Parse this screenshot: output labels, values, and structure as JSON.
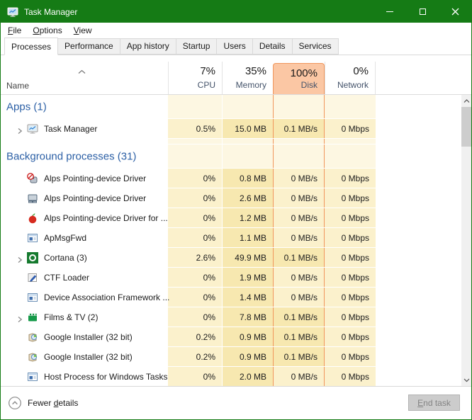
{
  "title_bar": {
    "title": "Task Manager"
  },
  "menu_bar": {
    "items": [
      {
        "key": "F",
        "rest": "ile"
      },
      {
        "key": "O",
        "rest": "ptions"
      },
      {
        "key": "V",
        "rest": "iew"
      }
    ]
  },
  "tabs": [
    {
      "label": "Processes",
      "active": true
    },
    {
      "label": "Performance",
      "active": false
    },
    {
      "label": "App history",
      "active": false
    },
    {
      "label": "Startup",
      "active": false
    },
    {
      "label": "Users",
      "active": false
    },
    {
      "label": "Details",
      "active": false
    },
    {
      "label": "Services",
      "active": false
    }
  ],
  "columns": {
    "name_label": "Name",
    "sort_direction": "ascending",
    "value_cols": [
      {
        "pct": "7%",
        "label": "CPU",
        "highlight": false
      },
      {
        "pct": "35%",
        "label": "Memory",
        "highlight": false
      },
      {
        "pct": "100%",
        "label": "Disk",
        "highlight": true
      },
      {
        "pct": "0%",
        "label": "Network",
        "highlight": false
      }
    ]
  },
  "rows": [
    {
      "type": "group",
      "label": "Apps (1)"
    },
    {
      "type": "proc",
      "label": "Task Manager",
      "icon": "task-manager",
      "expandable": true,
      "cells": [
        "0.5%",
        "15.0 MB",
        "0.1 MB/s",
        "0 Mbps"
      ],
      "heat": [
        "v0",
        "v1",
        "v1",
        "v0"
      ]
    },
    {
      "type": "spacer"
    },
    {
      "type": "group",
      "label": "Background processes (31)"
    },
    {
      "type": "proc",
      "label": "Alps Pointing-device Driver",
      "icon": "pointing-device-blocked",
      "expandable": false,
      "cells": [
        "0%",
        "0.8 MB",
        "0 MB/s",
        "0 Mbps"
      ],
      "heat": [
        "v0",
        "v1",
        "v0",
        "v0"
      ]
    },
    {
      "type": "proc",
      "label": "Alps Pointing-device Driver",
      "icon": "touchpad",
      "expandable": false,
      "cells": [
        "0%",
        "2.6 MB",
        "0 MB/s",
        "0 Mbps"
      ],
      "heat": [
        "v0",
        "v1",
        "v0",
        "v0"
      ]
    },
    {
      "type": "proc",
      "label": "Alps Pointing-device Driver for ...",
      "icon": "apple",
      "expandable": false,
      "cells": [
        "0%",
        "1.2 MB",
        "0 MB/s",
        "0 Mbps"
      ],
      "heat": [
        "v0",
        "v1",
        "v0",
        "v0"
      ]
    },
    {
      "type": "proc",
      "label": "ApMsgFwd",
      "icon": "window",
      "expandable": false,
      "cells": [
        "0%",
        "1.1 MB",
        "0 MB/s",
        "0 Mbps"
      ],
      "heat": [
        "v0",
        "v1",
        "v0",
        "v0"
      ]
    },
    {
      "type": "proc",
      "label": "Cortana (3)",
      "icon": "cortana",
      "expandable": true,
      "cells": [
        "2.6%",
        "49.9 MB",
        "0.1 MB/s",
        "0 Mbps"
      ],
      "heat": [
        "v0",
        "v1",
        "v1",
        "v0"
      ]
    },
    {
      "type": "proc",
      "label": "CTF Loader",
      "icon": "ctf-loader",
      "expandable": false,
      "cells": [
        "0%",
        "1.9 MB",
        "0 MB/s",
        "0 Mbps"
      ],
      "heat": [
        "v0",
        "v1",
        "v0",
        "v0"
      ]
    },
    {
      "type": "proc",
      "label": "Device Association Framework ...",
      "icon": "window",
      "expandable": false,
      "cells": [
        "0%",
        "1.4 MB",
        "0 MB/s",
        "0 Mbps"
      ],
      "heat": [
        "v0",
        "v1",
        "v0",
        "v0"
      ]
    },
    {
      "type": "proc",
      "label": "Films & TV (2)",
      "icon": "films-tv",
      "expandable": true,
      "cells": [
        "0%",
        "7.8 MB",
        "0.1 MB/s",
        "0 Mbps"
      ],
      "heat": [
        "v0",
        "v1",
        "v1",
        "v0"
      ]
    },
    {
      "type": "proc",
      "label": "Google Installer (32 bit)",
      "icon": "installer",
      "expandable": false,
      "cells": [
        "0.2%",
        "0.9 MB",
        "0.1 MB/s",
        "0 Mbps"
      ],
      "heat": [
        "v0",
        "v1",
        "v1",
        "v0"
      ]
    },
    {
      "type": "proc",
      "label": "Google Installer (32 bit)",
      "icon": "installer",
      "expandable": false,
      "cells": [
        "0.2%",
        "0.9 MB",
        "0.1 MB/s",
        "0 Mbps"
      ],
      "heat": [
        "v0",
        "v1",
        "v1",
        "v0"
      ]
    },
    {
      "type": "proc",
      "label": "Host Process for Windows Tasks",
      "icon": "window",
      "expandable": false,
      "cells": [
        "0%",
        "2.0 MB",
        "0 MB/s",
        "0 Mbps"
      ],
      "heat": [
        "v0",
        "v1",
        "v0",
        "v0"
      ]
    }
  ],
  "footer": {
    "fewer_details": {
      "pre": "Fewer ",
      "key": "d",
      "post": "etails"
    },
    "end_task": {
      "key": "E",
      "rest": "nd task"
    }
  },
  "icons": {
    "titlebar": "task-manager-icon",
    "window_controls": [
      "minimize-icon",
      "maximize-icon",
      "close-icon"
    ],
    "sort": "chevron-up-icon",
    "row_expand": "chevron-right-icon",
    "scrollbar": [
      "scroll-up-icon",
      "scroll-down-icon"
    ],
    "footer": "circled-chevron-up-icon"
  },
  "colors": {
    "accent_green": "#157b15",
    "group_header_blue": "#2b5fa5",
    "column_label_blue": "#44536a",
    "disk_highlight_fill": "#fbc7a4",
    "disk_highlight_border": "#f0965c",
    "heat_blank": "#fdf7e2",
    "heat_low": "#fbf1cc",
    "heat_mid": "#f7e8b0",
    "disabled_button_bg": "#cccccc"
  }
}
